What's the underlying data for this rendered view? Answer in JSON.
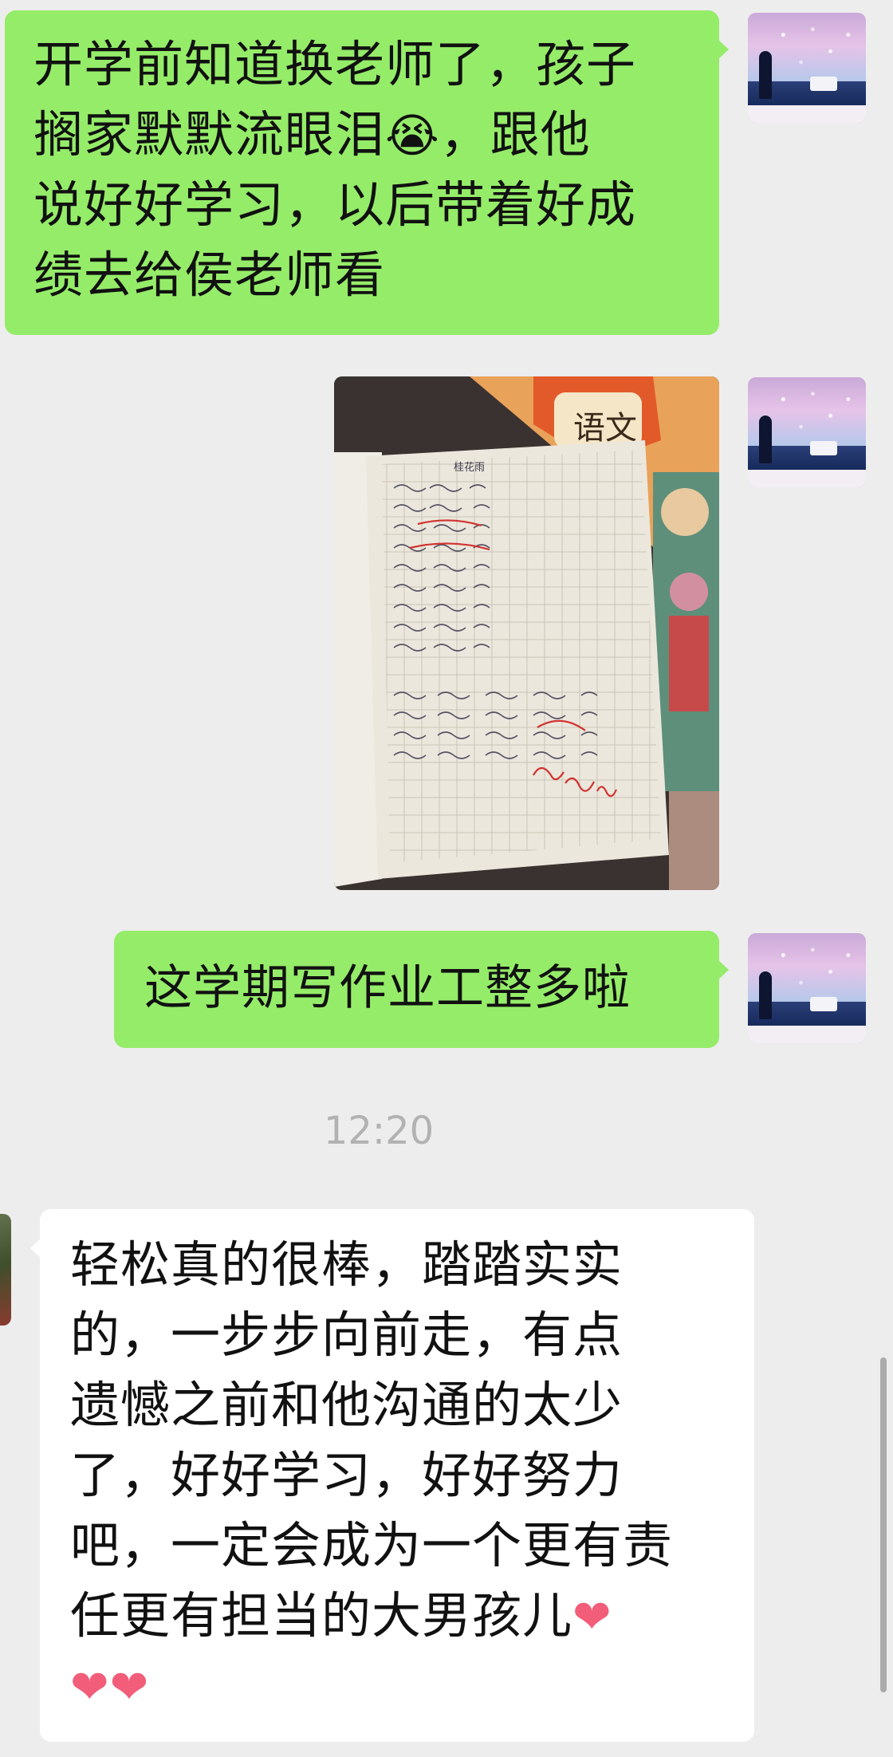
{
  "messages": [
    {
      "id": "msg1",
      "side": "right",
      "lines": [
        "开学前知道换老师了，孩子",
        "搁家默默流眼泪",
        "，跟他",
        "说好好学习，以后带着好成",
        "绩去给侯老师看"
      ],
      "emoji": "😭"
    },
    {
      "id": "msg2",
      "side": "right",
      "type": "image",
      "image_desc_icon": "homework-notebook-photo"
    },
    {
      "id": "msg3",
      "side": "right",
      "text": "这学期写作业工整多啦"
    },
    {
      "id": "msg4",
      "side": "left",
      "lines": [
        "轻松真的很棒，踏踏实实",
        "的，一步步向前走，有点",
        "遗憾之前和他沟通的太少",
        "了，好好学习，好好努力",
        "吧，一定会成为一个更有责",
        "任更有担当的大男孩儿"
      ],
      "hearts": [
        "❤",
        "❤",
        "❤"
      ]
    }
  ],
  "timestamp": "12:20",
  "notebook": {
    "cover_text": "语文",
    "title_row": "桂花雨"
  },
  "colors": {
    "background": "#EDEDED",
    "sent_bubble": "#95EC69",
    "received_bubble": "#FFFFFF",
    "timestamp_text": "#B2B2B2",
    "heart": "#F25D7A"
  }
}
